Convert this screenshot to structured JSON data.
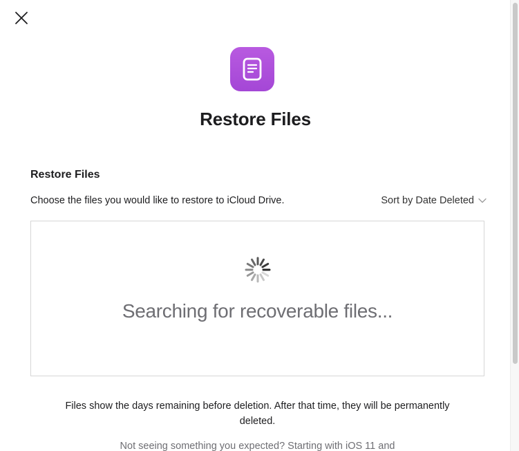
{
  "dialog": {
    "close_icon": "close-icon",
    "app_icon": "document-icon",
    "app_icon_color": "#a94fdb",
    "title": "Restore Files"
  },
  "section": {
    "heading": "Restore Files",
    "description": "Choose the files you would like to restore to iCloud Drive.",
    "sort_label": "Sort by Date Deleted",
    "sort_icon": "chevron-down-icon"
  },
  "results": {
    "loading_icon": "spinner-icon",
    "status_text": "Searching for recoverable files..."
  },
  "footer": {
    "note": "Files show the days remaining before deletion. After that time, they will be permanently deleted.",
    "hint": "Not seeing something you expected? Starting with iOS 11 and"
  }
}
